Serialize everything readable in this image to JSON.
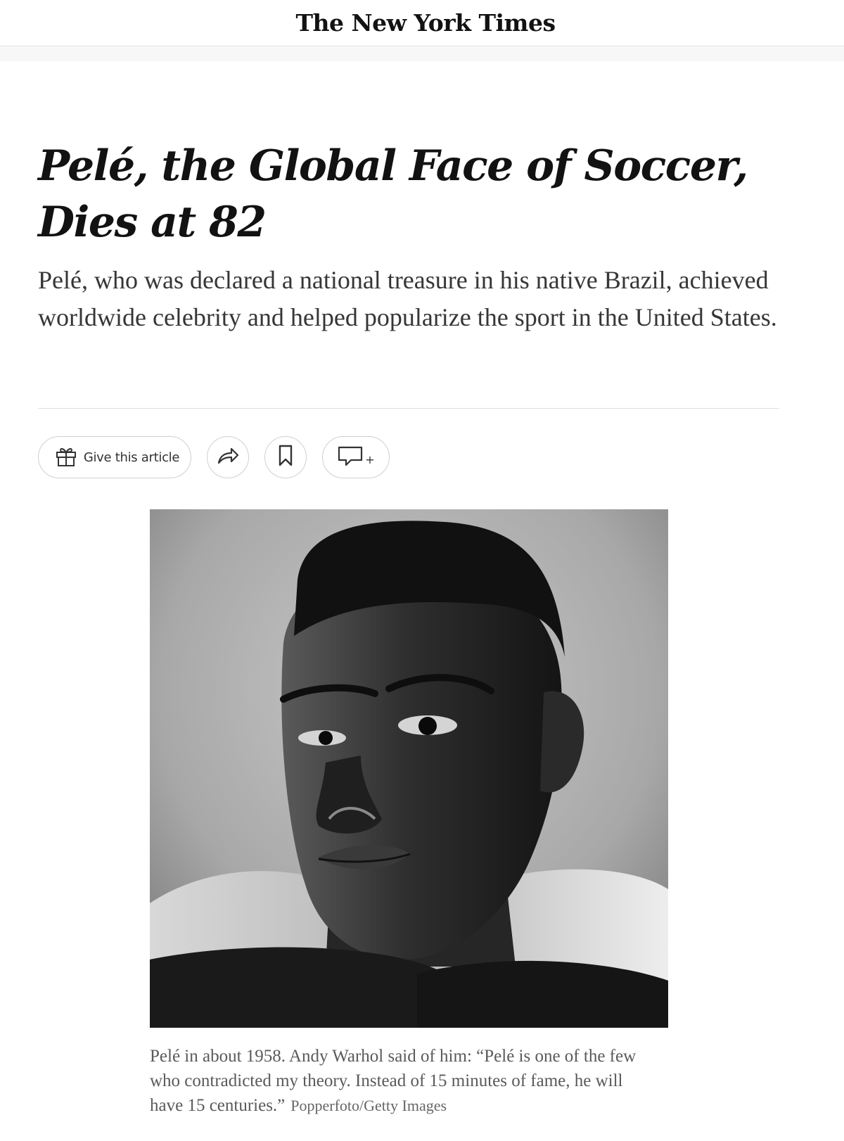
{
  "masthead": {
    "logo_text": "The New York Times"
  },
  "article": {
    "headline": "Pelé, the Global Face of Soccer, Dies at 82",
    "summary": "Pelé, who was declared a national treasure in his native Brazil, achieved worldwide celebrity and helped popularize the sport in the United States.",
    "toolbar": {
      "gift_label": "Give this article",
      "gift_icon": "gift-icon",
      "share_icon": "share-arrow-icon",
      "save_icon": "bookmark-icon",
      "comments_icon": "comment-bubble-icon",
      "comments_suffix": "+"
    },
    "image": {
      "caption": "Pelé in about 1958. Andy Warhol said of him: “Pelé is one of the few who contradicted my theory. Instead of 15 minutes of fame, he will have 15 centuries.”",
      "credit": "Popperfoto/Getty Images"
    }
  },
  "colors": {
    "text": "#121212",
    "summary_text": "#363636",
    "caption_text": "#5a5a5a",
    "rule": "#dfdfdf"
  }
}
